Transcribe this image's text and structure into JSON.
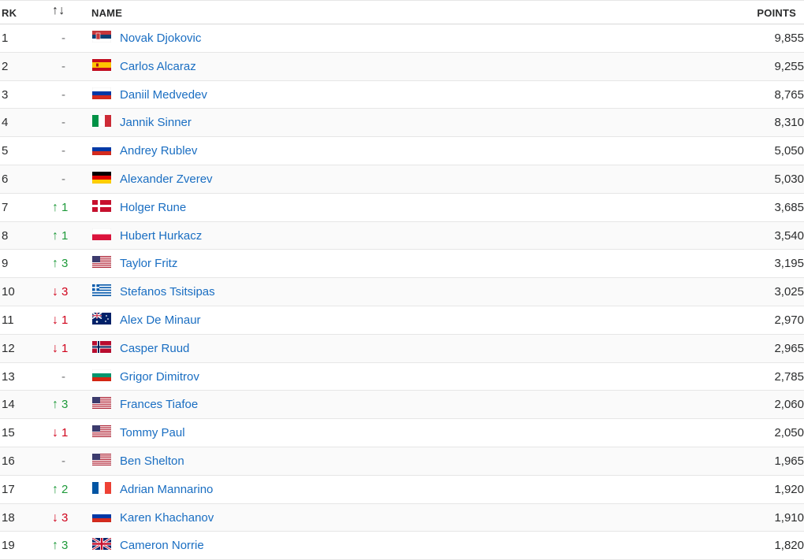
{
  "header": {
    "rank": "RK",
    "trend": "↑↓",
    "name": "NAME",
    "points": "POINTS"
  },
  "rows": [
    {
      "rank": "1",
      "trend": "-",
      "trend_dir": "none",
      "flag": "SRB",
      "name": "Novak Djokovic",
      "points": "9,855"
    },
    {
      "rank": "2",
      "trend": "-",
      "trend_dir": "none",
      "flag": "ESP",
      "name": "Carlos Alcaraz",
      "points": "9,255"
    },
    {
      "rank": "3",
      "trend": "-",
      "trend_dir": "none",
      "flag": "RUS",
      "name": "Daniil Medvedev",
      "points": "8,765"
    },
    {
      "rank": "4",
      "trend": "-",
      "trend_dir": "none",
      "flag": "ITA",
      "name": "Jannik Sinner",
      "points": "8,310"
    },
    {
      "rank": "5",
      "trend": "-",
      "trend_dir": "none",
      "flag": "RUS",
      "name": "Andrey Rublev",
      "points": "5,050"
    },
    {
      "rank": "6",
      "trend": "-",
      "trend_dir": "none",
      "flag": "GER",
      "name": "Alexander Zverev",
      "points": "5,030"
    },
    {
      "rank": "7",
      "trend": "1",
      "trend_dir": "up",
      "flag": "DEN",
      "name": "Holger Rune",
      "points": "3,685"
    },
    {
      "rank": "8",
      "trend": "1",
      "trend_dir": "up",
      "flag": "POL",
      "name": "Hubert Hurkacz",
      "points": "3,540"
    },
    {
      "rank": "9",
      "trend": "3",
      "trend_dir": "up",
      "flag": "USA",
      "name": "Taylor Fritz",
      "points": "3,195"
    },
    {
      "rank": "10",
      "trend": "3",
      "trend_dir": "down",
      "flag": "GRE",
      "name": "Stefanos Tsitsipas",
      "points": "3,025"
    },
    {
      "rank": "11",
      "trend": "1",
      "trend_dir": "down",
      "flag": "AUS",
      "name": "Alex De Minaur",
      "points": "2,970"
    },
    {
      "rank": "12",
      "trend": "1",
      "trend_dir": "down",
      "flag": "NOR",
      "name": "Casper Ruud",
      "points": "2,965"
    },
    {
      "rank": "13",
      "trend": "-",
      "trend_dir": "none",
      "flag": "BUL",
      "name": "Grigor Dimitrov",
      "points": "2,785"
    },
    {
      "rank": "14",
      "trend": "3",
      "trend_dir": "up",
      "flag": "USA",
      "name": "Frances Tiafoe",
      "points": "2,060"
    },
    {
      "rank": "15",
      "trend": "1",
      "trend_dir": "down",
      "flag": "USA",
      "name": "Tommy Paul",
      "points": "2,050"
    },
    {
      "rank": "16",
      "trend": "-",
      "trend_dir": "none",
      "flag": "USA",
      "name": "Ben Shelton",
      "points": "1,965"
    },
    {
      "rank": "17",
      "trend": "2",
      "trend_dir": "up",
      "flag": "FRA",
      "name": "Adrian Mannarino",
      "points": "1,920"
    },
    {
      "rank": "18",
      "trend": "3",
      "trend_dir": "down",
      "flag": "RUS",
      "name": "Karen Khachanov",
      "points": "1,910"
    },
    {
      "rank": "19",
      "trend": "3",
      "trend_dir": "up",
      "flag": "GBR",
      "name": "Cameron Norrie",
      "points": "1,820"
    }
  ],
  "colors": {
    "link": "#1a6ec2",
    "up": "#1e9a3a",
    "down": "#d0021b"
  }
}
